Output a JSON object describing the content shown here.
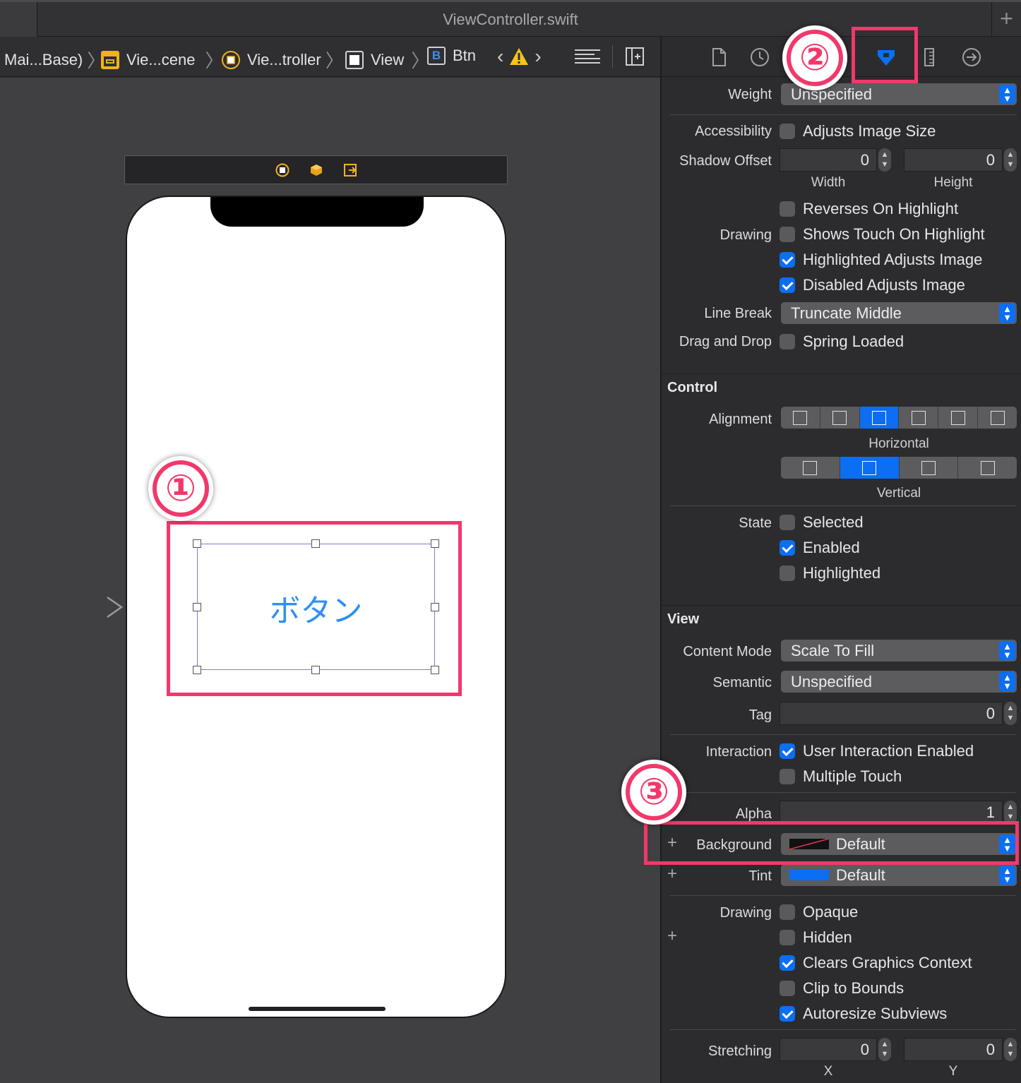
{
  "window": {
    "title": "ViewController.swift"
  },
  "jumpbar": {
    "crumbs": [
      "Mai...Base)",
      "Vie...cene",
      "Vie...troller",
      "View",
      "Btn"
    ],
    "btn_icon_letter": "B"
  },
  "canvas": {
    "button_label": "ボタン"
  },
  "annotations": {
    "one": "①",
    "two": "②",
    "three": "③"
  },
  "inspector": {
    "weight": {
      "label": "Weight",
      "value": "Unspecified"
    },
    "accessibility": {
      "label": "Accessibility",
      "option": "Adjusts Image Size",
      "checked": false
    },
    "shadow_offset": {
      "label": "Shadow Offset",
      "width": "0",
      "height": "0",
      "width_label": "Width",
      "height_label": "Height"
    },
    "drawing1": {
      "label": "Drawing",
      "options": [
        {
          "text": "Reverses On Highlight",
          "checked": false
        },
        {
          "text": "Shows Touch On Highlight",
          "checked": false
        },
        {
          "text": "Highlighted Adjusts Image",
          "checked": true
        },
        {
          "text": "Disabled Adjusts Image",
          "checked": true
        }
      ]
    },
    "line_break": {
      "label": "Line Break",
      "value": "Truncate Middle"
    },
    "drag_drop": {
      "label": "Drag and Drop",
      "option": "Spring Loaded",
      "checked": false
    },
    "control": {
      "section": "Control",
      "alignment_label": "Alignment",
      "horizontal_label": "Horizontal",
      "vertical_label": "Vertical",
      "state_label": "State",
      "states": [
        {
          "text": "Selected",
          "checked": false
        },
        {
          "text": "Enabled",
          "checked": true
        },
        {
          "text": "Highlighted",
          "checked": false
        }
      ]
    },
    "view": {
      "section": "View",
      "content_mode": {
        "label": "Content Mode",
        "value": "Scale To Fill"
      },
      "semantic": {
        "label": "Semantic",
        "value": "Unspecified"
      },
      "tag": {
        "label": "Tag",
        "value": "0"
      },
      "interaction_label": "Interaction",
      "interactions": [
        {
          "text": "User Interaction Enabled",
          "checked": true
        },
        {
          "text": "Multiple Touch",
          "checked": false
        }
      ],
      "alpha": {
        "label": "Alpha",
        "value": "1"
      },
      "background": {
        "label": "Background",
        "value": "Default"
      },
      "tint": {
        "label": "Tint",
        "value": "Default",
        "color": "#0b6ef3"
      },
      "drawing_label": "Drawing",
      "drawing_options": [
        {
          "text": "Opaque",
          "checked": false
        },
        {
          "text": "Hidden",
          "checked": false
        },
        {
          "text": "Clears Graphics Context",
          "checked": true
        },
        {
          "text": "Clip to Bounds",
          "checked": false
        },
        {
          "text": "Autoresize Subviews",
          "checked": true
        }
      ],
      "stretching": {
        "label": "Stretching",
        "x": "0",
        "y": "0",
        "x_label": "X",
        "y_label": "Y"
      }
    }
  },
  "colors": {
    "accent": "#0b6ef3",
    "highlight": "#f2386b",
    "button_text": "#2f8ff3"
  }
}
